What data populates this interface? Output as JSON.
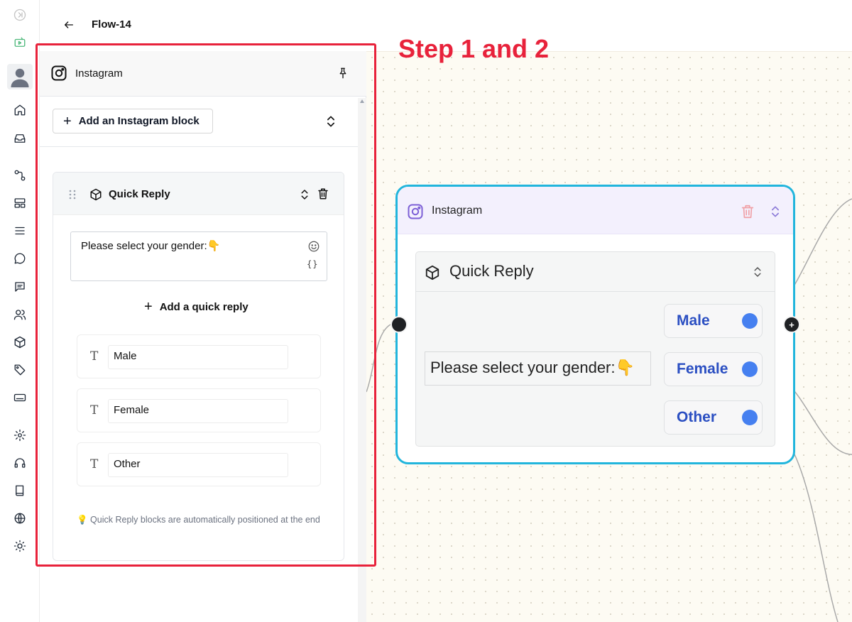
{
  "header": {
    "back_label": "←",
    "flow_title": "Flow-14"
  },
  "sidebar": {
    "items": [
      {
        "name": "collapse-icon"
      },
      {
        "name": "broadcast-icon"
      },
      {
        "name": "avatar"
      },
      {
        "name": "home-icon"
      },
      {
        "name": "inbox-icon"
      },
      {
        "name": "flows-icon"
      },
      {
        "name": "templates-icon"
      },
      {
        "name": "menu-icon"
      },
      {
        "name": "chat-icon"
      },
      {
        "name": "messages-icon"
      },
      {
        "name": "contacts-icon"
      },
      {
        "name": "blocks-icon"
      },
      {
        "name": "tags-icon"
      },
      {
        "name": "keyboard-icon"
      },
      {
        "name": "settings-icon"
      },
      {
        "name": "support-icon"
      },
      {
        "name": "docs-icon"
      },
      {
        "name": "globe-icon"
      },
      {
        "name": "theme-icon"
      }
    ]
  },
  "panel": {
    "channel_title": "Instagram",
    "add_block_label": "Add an Instagram block",
    "block": {
      "title": "Quick Reply",
      "message": "Please select your gender:👇",
      "variables_label": "{}",
      "add_reply_label": "Add a quick reply",
      "replies": [
        "Male",
        "Female",
        "Other"
      ],
      "note": "💡 Quick Reply blocks are automatically positioned at the end"
    }
  },
  "annotation": {
    "step_label": "Step 1 and 2",
    "color": "#e8223b"
  },
  "node": {
    "channel_title": "Instagram",
    "block_title": "Quick Reply",
    "message": "Please select your gender:👇",
    "replies": [
      "Male",
      "Female",
      "Other"
    ],
    "out_handle_label": "+",
    "border_color": "#21b5dc",
    "reply_dot_color": "#4680f0"
  }
}
